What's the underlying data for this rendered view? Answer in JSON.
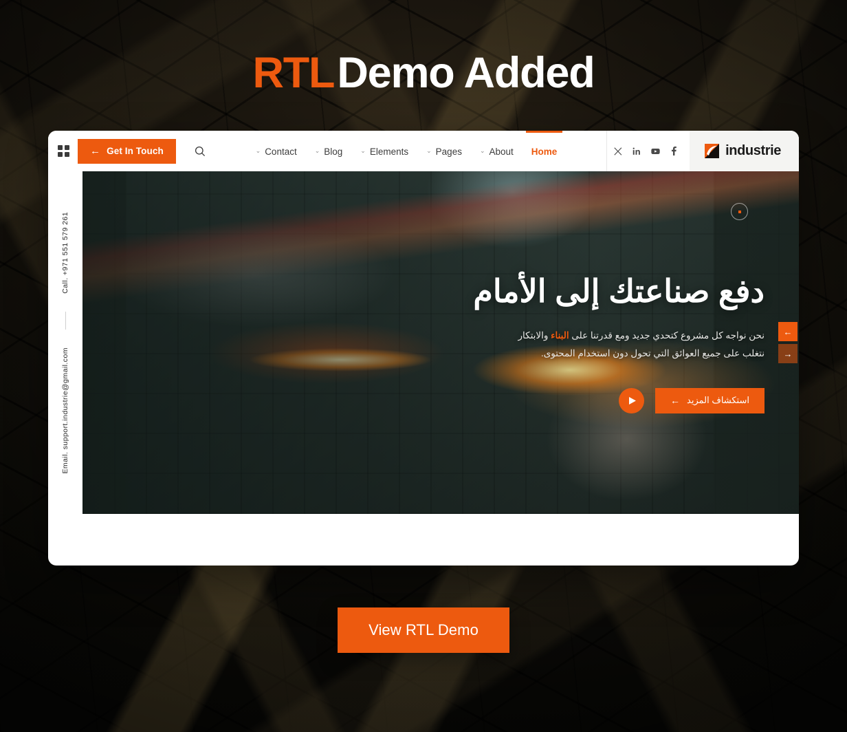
{
  "headline": {
    "accent": "RTL",
    "rest": "Demo Added"
  },
  "browser_card": {
    "header": {
      "grid_menu_icon": "grid-icon",
      "get_in_touch": {
        "label": "Get In Touch",
        "arrow": "←"
      },
      "search_icon": "search-icon",
      "nav_items": [
        {
          "label": "Contact",
          "chevron": "⌄",
          "active": false
        },
        {
          "label": "Blog",
          "chevron": "⌄",
          "active": false
        },
        {
          "label": "Elements",
          "chevron": "⌄",
          "active": false
        },
        {
          "label": "Pages",
          "chevron": "⌄",
          "active": false
        },
        {
          "label": "About",
          "chevron": "⌄",
          "active": false
        },
        {
          "label": "Home",
          "chevron": "",
          "active": true
        }
      ],
      "socials": [
        {
          "name": "x-twitter-icon"
        },
        {
          "name": "linkedin-icon"
        },
        {
          "name": "youtube-icon"
        },
        {
          "name": "facebook-icon"
        }
      ],
      "brand": {
        "name": "industrie",
        "mark": "industrie-logo-mark"
      }
    },
    "rail": {
      "call": "Call. +971 551 579 261",
      "email": "Email. support.industrie@gmail.com"
    },
    "hero": {
      "title": "دفع صناعتك إلى الأمام",
      "desc_before": "نحن نواجه كل مشروع كتحدي جديد ومع قدرتنا على ",
      "desc_highlight": "البناء",
      "desc_after": " والابتكار نتغلب على جميع العوائق التي تحول دون استخدام المحتوى.",
      "explore_button": "استكشاف المزيد",
      "explore_arrow": "←",
      "play_icon": "play-icon",
      "slider_prev": "←",
      "slider_next": "→"
    }
  },
  "cta": {
    "label": "View RTL Demo"
  },
  "colors": {
    "accent_orange": "#ED5A0F",
    "card_white": "#FFFFFF",
    "backdrop_dark": "#0D0C0A",
    "brand_dark": "#1B1B1B"
  }
}
